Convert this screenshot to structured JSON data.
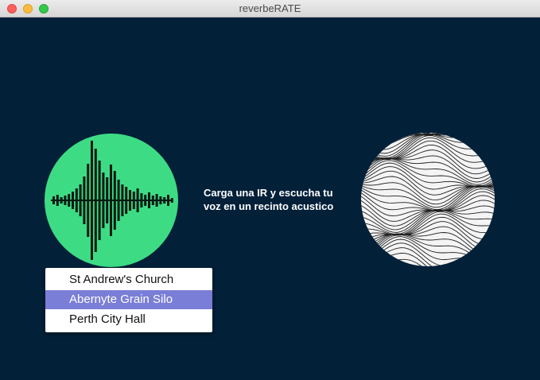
{
  "window": {
    "title": "reverbeRATE",
    "controls": [
      "close",
      "minimize",
      "zoom"
    ]
  },
  "main": {
    "prompt_text": "Carga una IR y escucha tu voz en un recinto acustico",
    "left_visual": {
      "icon": "sound-wave-icon",
      "color": "#3ddc84"
    },
    "right_visual": {
      "icon": "wavy-lines-texture"
    }
  },
  "venue_dropdown": {
    "options": [
      {
        "label": "St Andrew's Church",
        "selected": false
      },
      {
        "label": "Abernyte Grain Silo",
        "selected": true
      },
      {
        "label": "Perth City Hall",
        "selected": false
      }
    ],
    "selected_label": "Abernyte Grain Silo"
  },
  "colors": {
    "background": "#032039",
    "accent_green": "#3ddc84",
    "selection": "#7b7ed6"
  }
}
